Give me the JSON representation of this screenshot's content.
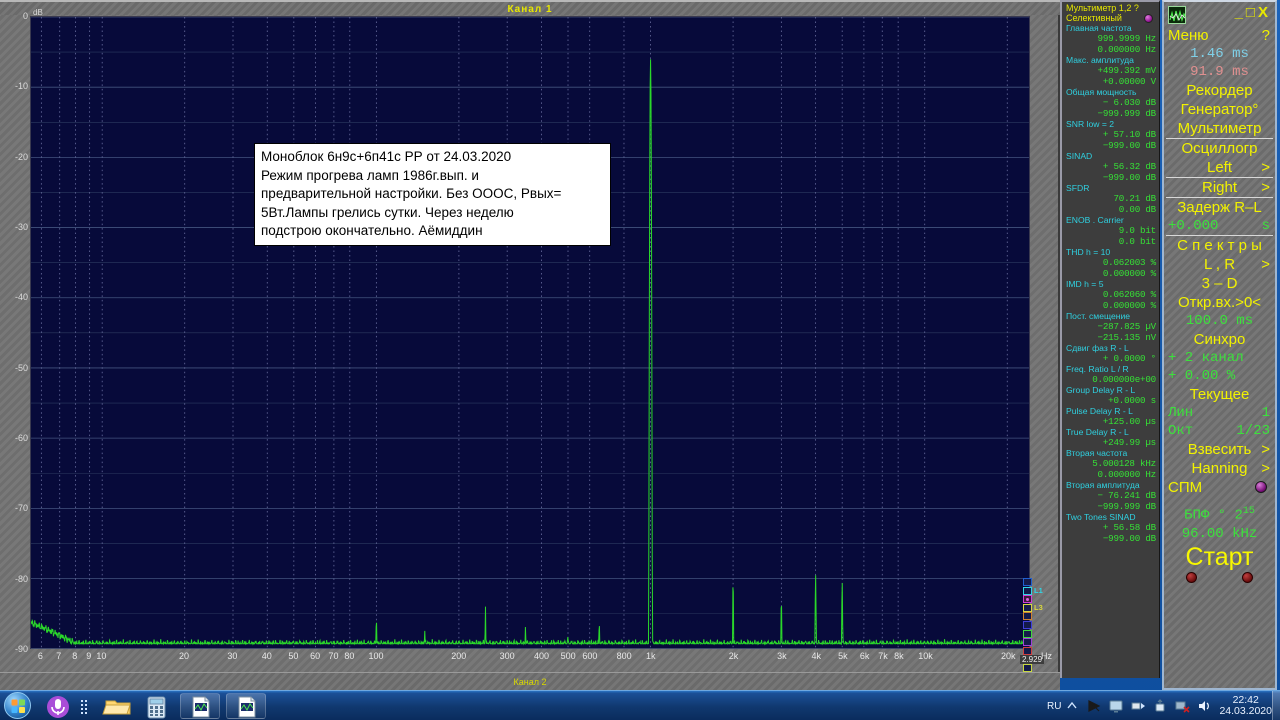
{
  "window": {
    "title": "Канал 1",
    "bottom_title": "Канал 2"
  },
  "note": {
    "text": "Моноблок 6н9с+6п41с РР от 24.03.2020\n Режим прогрева ламп 1986г.вып. и\nпредварительной настройки. Без ОООС, Рвых=\n5Вт.Лампы грелись сутки. Через неделю\nподстрою окончательно. Аёмиддин"
  },
  "legend": {
    "items": [
      {
        "tag": "",
        "color": "#2060d0"
      },
      {
        "tag": "L1",
        "color": "#30d8e8"
      },
      {
        "tag": "",
        "color": "#d040d8"
      },
      {
        "tag": "L3",
        "color": "#d8d840"
      },
      {
        "tag": "",
        "color": "#d08030"
      },
      {
        "tag": "",
        "color": "#4040d8"
      },
      {
        "tag": "",
        "color": "#40d840"
      },
      {
        "tag": "",
        "color": "#a040d8"
      },
      {
        "tag": "",
        "color": "#d04040"
      },
      {
        "tag": "",
        "color": "#d8b040"
      },
      {
        "tag": "",
        "color": "#c8d840"
      }
    ],
    "value": "2.929"
  },
  "multimeter": {
    "title": "Мультиметр 1,2  ?",
    "mode": "Селективный",
    "rows": [
      {
        "label": "Главная частота",
        "v1": "999.9999  Hz",
        "v2": "0.000000  Hz"
      },
      {
        "label": "Макс. амплитуда",
        "v1": "+499.392 mV",
        "v2": "+0.00000  V"
      },
      {
        "label": "Общая мощность",
        "v1": "−    6.030 dB",
        "v2": "−999.999 dB"
      },
      {
        "label": "SNR       low =    2",
        "v1": "+  57.10 dB",
        "v2": "−999.00 dB"
      },
      {
        "label": "SINAD",
        "v1": "+  56.32 dB",
        "v2": "−999.00 dB"
      },
      {
        "label": "SFDR",
        "v1": "70.21 dB",
        "v2": "0.00 dB"
      },
      {
        "label": "ENOB . Carrier",
        "v1": "9.0 bit",
        "v2": "0.0 bit"
      },
      {
        "label": "THD       h =   10",
        "v1": "0.062003 %",
        "v2": "0.000000 %"
      },
      {
        "label": "IMD        h =    5",
        "v1": "0.062060 %",
        "v2": "0.000000 %"
      },
      {
        "label": "Пост. смещение",
        "v1": "−287.825 µV",
        "v2": "−215.135 nV"
      },
      {
        "label": "Сдвиг фаз R - L",
        "v1": "+    0.0000 °",
        "v2": ""
      },
      {
        "label": "Freq. Ratio  L / R",
        "v1": "0.000000e+00",
        "v2": ""
      },
      {
        "label": "Group Delay R - L",
        "v1": "+0.0000   s",
        "v2": ""
      },
      {
        "label": "Pulse Delay R - L",
        "v1": "+125.00 µs",
        "v2": ""
      },
      {
        "label": "True Delay R - L",
        "v1": "+249.99 µs",
        "v2": ""
      },
      {
        "label": "Вторая частота",
        "v1": "5.000128 kHz",
        "v2": "0.000000  Hz"
      },
      {
        "label": "Вторая амплитуда",
        "v1": "−  76.241 dB",
        "v2": "−999.999 dB"
      },
      {
        "label": "Two Tones SINAD",
        "v1": "+  56.58 dB",
        "v2": "−999.00 dB"
      }
    ]
  },
  "controls": {
    "minimize": "_",
    "maximize": "□",
    "close": "X",
    "menu": "Меню",
    "help": "?",
    "time_cyan": "1.46 ms",
    "time_pink": "91.9 ms",
    "recorder": "Рекордер",
    "generator": "Генератор°",
    "multimeter": "Мультиметр",
    "oscillograph": "Осциллогр",
    "left": "Left",
    "left_arrow": ">",
    "right": "Right",
    "right_arrow": ">",
    "delay_label": "Задерж  R–L",
    "delay_value": "+0.000",
    "delay_unit": "s",
    "spectra": "С п е к т р ы",
    "lr": "L , R",
    "lr_arrow": ">",
    "three_d": "3 – D",
    "open_input": "Откр.вх.>0<",
    "open_input_value": "100.0 ms",
    "sync": "Синхро",
    "sync_channel": "+  2 канал",
    "sync_percent": "+  0.00 %",
    "current": "Текущее",
    "lin": "Лин",
    "lin_value": "1",
    "oct": "Окт",
    "oct_value": "1/23",
    "weight": "Взвесить",
    "weight_arrow": ">",
    "window_fn": "Hanning",
    "window_arrow": ">",
    "spm": "СПМ",
    "fft": "БПФ ° 2",
    "fft_exp": "15",
    "sample_rate": "96.00 kHz",
    "start": "Старт"
  },
  "chart_data": {
    "type": "line",
    "title": "Канал 1",
    "xlabel": "Hz",
    "ylabel": "dB",
    "xscale": "log",
    "xlim": [
      5.5,
      24000
    ],
    "ylim": [
      -90,
      0
    ],
    "ytick_values": [
      0,
      -10,
      -20,
      -30,
      -40,
      -50,
      -60,
      -70,
      -80,
      -90
    ],
    "ytick_labels": [
      "0",
      "-10",
      "-20",
      "-30",
      "-40",
      "-50",
      "-60",
      "-70",
      "-80",
      "-90"
    ],
    "xtick_values": [
      6,
      7,
      8,
      9,
      10,
      20,
      30,
      40,
      50,
      60,
      70,
      80,
      100,
      200,
      300,
      400,
      500,
      600,
      800,
      1000,
      2000,
      3000,
      4000,
      5000,
      6000,
      7000,
      8000,
      10000,
      20000
    ],
    "xtick_labels": [
      "6",
      "7",
      "8",
      "9",
      "10",
      "20",
      "30",
      "40",
      "50",
      "60",
      "70",
      "80",
      "100",
      "200",
      "300",
      "400",
      "500",
      "600",
      "800",
      "1k",
      "2k",
      "3k",
      "4k",
      "5k",
      "6k",
      "7k",
      "8k",
      "10k",
      "20k"
    ],
    "grid": true,
    "trace_color": "#2ad82a",
    "noise_floor_db": -89.3,
    "peaks": [
      {
        "freq": 100,
        "db": -85.5
      },
      {
        "freq": 150,
        "db": -87.0
      },
      {
        "freq": 250,
        "db": -84.0
      },
      {
        "freq": 350,
        "db": -86.5
      },
      {
        "freq": 500,
        "db": -87.5
      },
      {
        "freq": 650,
        "db": -86.0
      },
      {
        "freq": 1000,
        "db": -6.0
      },
      {
        "freq": 2000,
        "db": -80.5
      },
      {
        "freq": 3000,
        "db": -83.0
      },
      {
        "freq": 4000,
        "db": -79.5
      },
      {
        "freq": 5000,
        "db": -80.5
      }
    ]
  },
  "taskbar": {
    "buttons": [
      {
        "name": "start-orb"
      },
      {
        "name": "microphone"
      },
      {
        "name": "explorer"
      },
      {
        "name": "calculator"
      },
      {
        "name": "document-1"
      },
      {
        "name": "document-2"
      }
    ],
    "language": "RU",
    "time": "22:42",
    "date": "24.03.2020"
  }
}
